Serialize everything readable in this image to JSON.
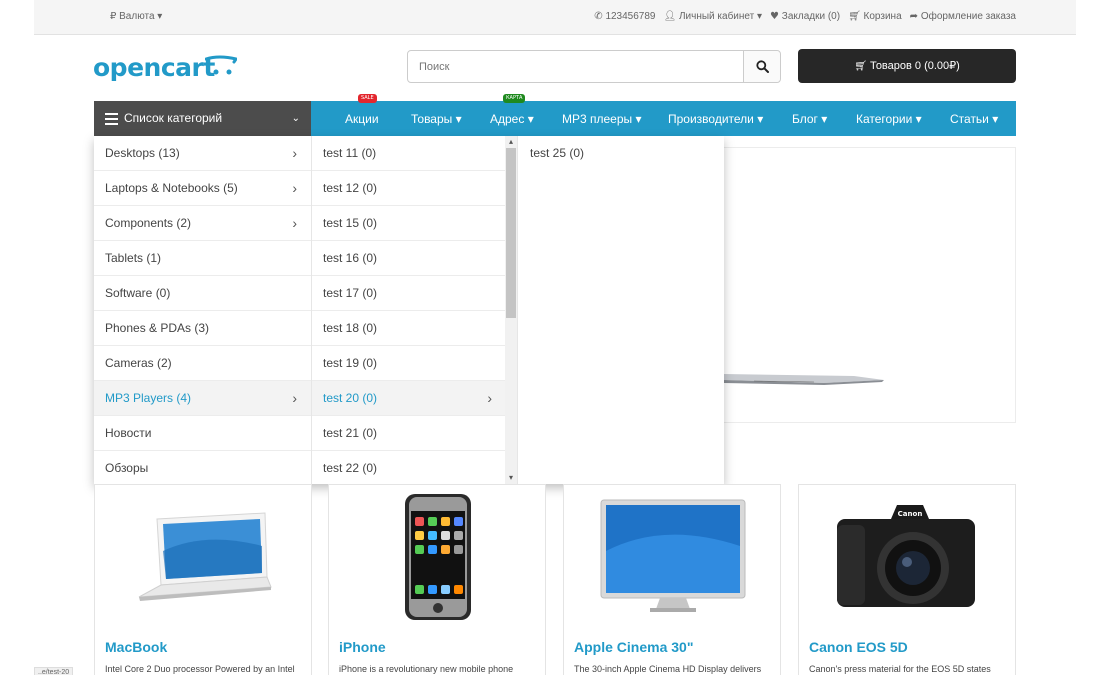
{
  "topbar": {
    "currency": "₽ Валюта ▾",
    "phone": "123456789",
    "account": "Личный кабинет ▾",
    "wishlist": "Закладки (0)",
    "cart": "Корзина",
    "checkout": "Оформление заказа"
  },
  "header": {
    "logo": "opencart",
    "search_placeholder": "Поиск",
    "cart_button": "Товаров 0 (0.00₽)"
  },
  "nav": {
    "categories_button": "Список категорий",
    "items": [
      {
        "label": "Акции",
        "badge": "SALE",
        "badge_color": "#e3262d"
      },
      {
        "label": "Товары ▾"
      },
      {
        "label": "Адрес ▾",
        "badge": "КАРТА",
        "badge_color": "#1f8a1f"
      },
      {
        "label": "MP3 плееры ▾"
      },
      {
        "label": "Производители ▾"
      },
      {
        "label": "Блог ▾"
      },
      {
        "label": "Категории ▾"
      },
      {
        "label": "Статьи ▾"
      }
    ]
  },
  "categories": [
    {
      "label": "Desktops (13)",
      "has_children": true
    },
    {
      "label": "Laptops & Notebooks (5)",
      "has_children": true
    },
    {
      "label": "Components (2)",
      "has_children": true
    },
    {
      "label": "Tablets (1)"
    },
    {
      "label": "Software (0)"
    },
    {
      "label": "Phones & PDAs (3)"
    },
    {
      "label": "Cameras (2)"
    },
    {
      "label": "MP3 Players (4)",
      "has_children": true,
      "active": true
    },
    {
      "label": "Новости"
    },
    {
      "label": "Обзоры"
    }
  ],
  "subcategories": [
    {
      "label": "test 11 (0)"
    },
    {
      "label": "test 12 (0)"
    },
    {
      "label": "test 15 (0)"
    },
    {
      "label": "test 16 (0)"
    },
    {
      "label": "test 17 (0)"
    },
    {
      "label": "test 18 (0)"
    },
    {
      "label": "test 19 (0)"
    },
    {
      "label": "test 20 (0)",
      "has_children": true,
      "active": true
    },
    {
      "label": "test 21 (0)"
    },
    {
      "label": "test 22 (0)"
    }
  ],
  "third_level": [
    {
      "label": "test 25 (0)"
    }
  ],
  "products": [
    {
      "name": "MacBook",
      "desc": "Intel Core 2 Duo processor Powered by an Intel",
      "icon": "macbook-image"
    },
    {
      "name": "iPhone",
      "desc": "iPhone is a revolutionary new mobile phone",
      "icon": "iphone-image"
    },
    {
      "name": "Apple Cinema 30\"",
      "desc": "The 30-inch Apple Cinema HD Display delivers",
      "icon": "cinema-display-image"
    },
    {
      "name": "Canon EOS 5D",
      "desc": "Canon's press material for the EOS 5D states",
      "icon": "camera-image"
    }
  ],
  "status_url": "..e/test-20",
  "colors": {
    "accent": "#229ac8",
    "nav_dark": "#4c4c4c",
    "cart_btn": "#272727"
  }
}
